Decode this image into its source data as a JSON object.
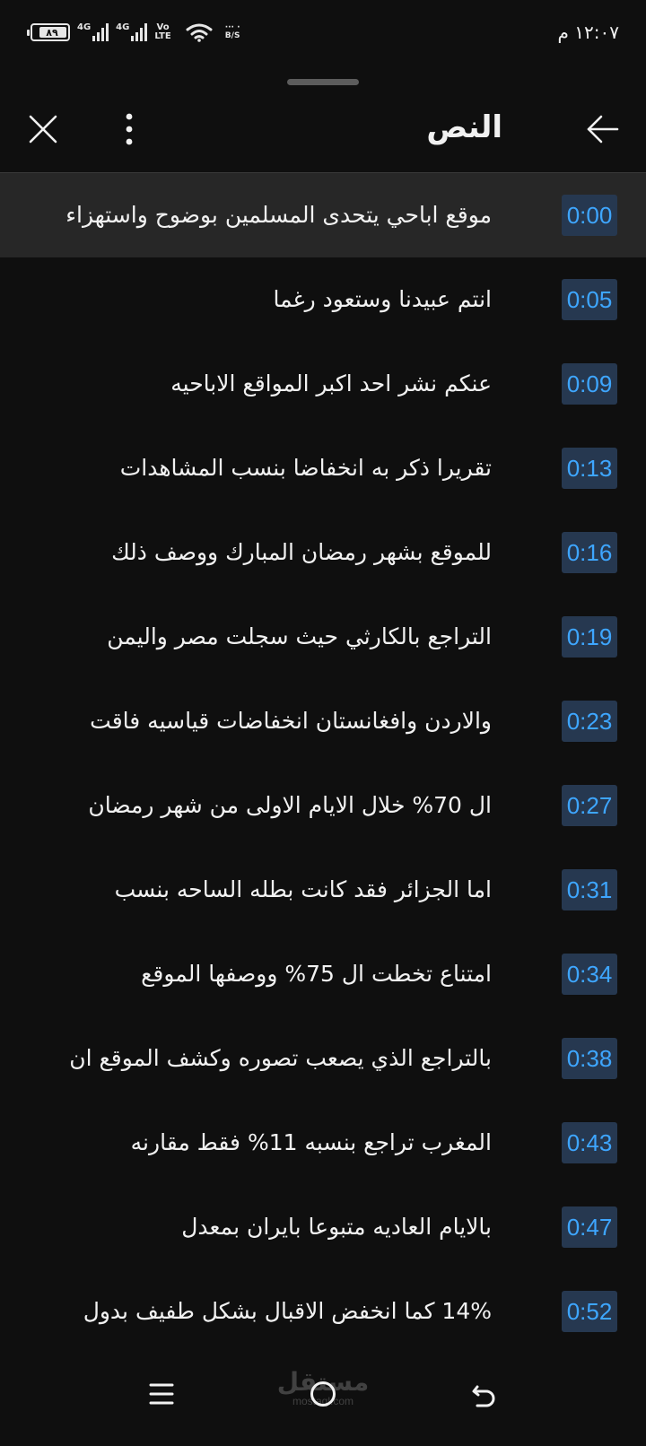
{
  "status_bar": {
    "battery_level": "٨٩",
    "network_1": "4G",
    "network_2": "4G",
    "volte_top": "Vo",
    "volte_bottom": "LTE",
    "speed_top": "··· ·",
    "speed_bottom": "B/S",
    "time": "١٢:٠٧ م"
  },
  "header": {
    "title": "النص",
    "icons": {
      "close": "close-icon",
      "more": "more-vert-icon",
      "back": "arrow-back-icon"
    }
  },
  "colors": {
    "background": "#0f0f0f",
    "active_row": "#272727",
    "timestamp_bg": "#263850",
    "timestamp_text": "#3ea6ff",
    "text": "#f1f1f1"
  },
  "transcript": [
    {
      "time": "0:00",
      "text": "موقع اباحي يتحدى المسلمين بوضوح واستهزاء",
      "active": true
    },
    {
      "time": "0:05",
      "text": "انتم عبيدنا وستعود رغما"
    },
    {
      "time": "0:09",
      "text": "عنكم نشر احد اكبر المواقع الاباحيه"
    },
    {
      "time": "0:13",
      "text": "تقريرا ذكر به انخفاضا بنسب المشاهدات"
    },
    {
      "time": "0:16",
      "text": "للموقع بشهر رمضان المبارك ووصف ذلك"
    },
    {
      "time": "0:19",
      "text": "التراجع بالكارثي حيث سجلت مصر واليمن"
    },
    {
      "time": "0:23",
      "text": "والاردن وافغانستان انخفاضات قياسيه فاقت"
    },
    {
      "time": "0:27",
      "text": "ال 70% خلال الايام الاولى من شهر رمضان"
    },
    {
      "time": "0:31",
      "text": "اما الجزائر فقد كانت بطله الساحه بنسب"
    },
    {
      "time": "0:34",
      "text": "امتناع تخطت ال 75% ووصفها الموقع"
    },
    {
      "time": "0:38",
      "text": "بالتراجع الذي يصعب تصوره وكشف الموقع ان"
    },
    {
      "time": "0:43",
      "text": "المغرب تراجع بنسبه 11% فقط مقارنه"
    },
    {
      "time": "0:47",
      "text": "بالايام العاديه متبوعا بايران بمعدل"
    },
    {
      "time": "0:52",
      "text": "14% كما انخفض الاقبال بشكل طفيف بدول"
    }
  ],
  "watermark": {
    "main": "مستقل",
    "sub": "mostaql.com"
  },
  "navbar": {
    "icons": {
      "menu": "recent-apps-icon",
      "home": "home-circle-icon",
      "back": "nav-back-icon"
    }
  }
}
